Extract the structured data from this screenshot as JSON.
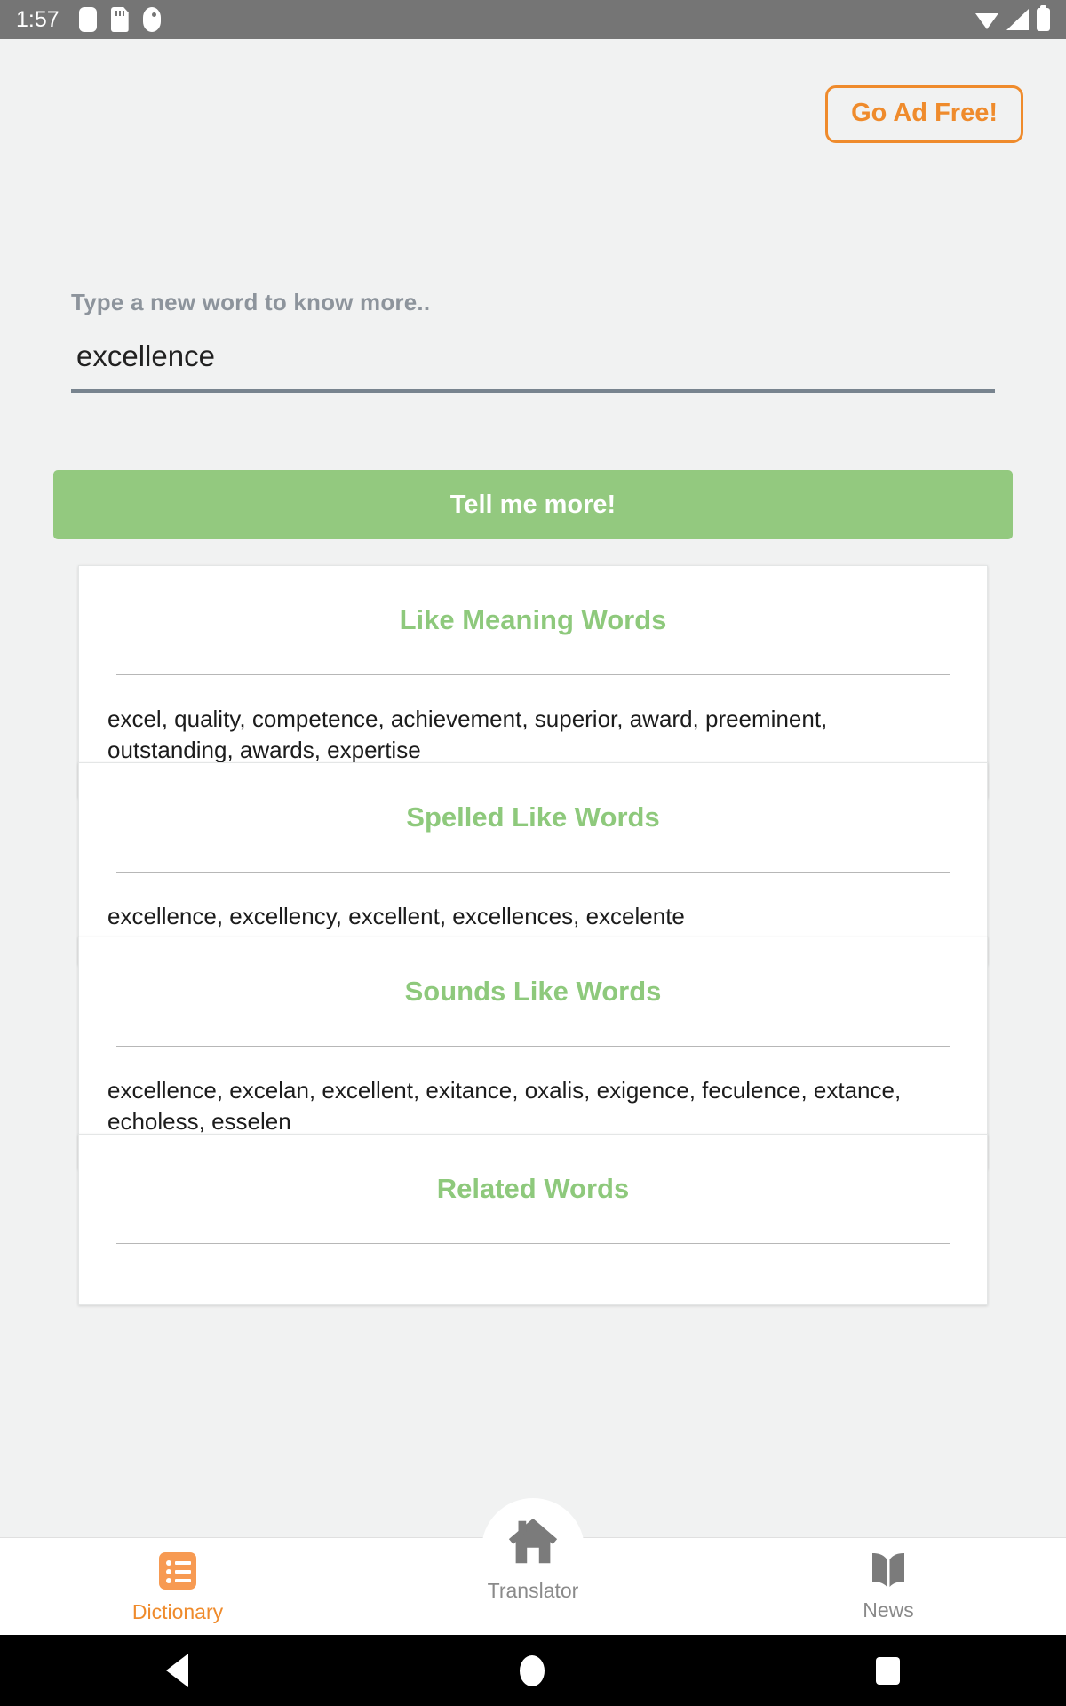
{
  "status_bar": {
    "clock": "1:57",
    "left_icons": [
      "app-notification-icon",
      "sd-card-icon",
      "app-badge-icon"
    ],
    "right_icons": [
      "wifi-icon",
      "cellular-signal-icon",
      "battery-icon"
    ],
    "background": "#757575"
  },
  "promo": {
    "label": "Go Ad Free!",
    "accent": "#ef8b2c"
  },
  "search": {
    "label": "Type a new word to know more..",
    "value": "excellence",
    "placeholder": "Type a new word to know more..",
    "submit_label": "Tell me more!",
    "submit_color": "#93c97f"
  },
  "cards": [
    {
      "title": "Like Meaning Words",
      "body": "excel, quality, competence, achievement, superior, award, preeminent, outstanding, awards, expertise"
    },
    {
      "title": "Spelled Like Words",
      "body": "excellence, excellency, excellent, excellences, excelente"
    },
    {
      "title": "Sounds Like Words",
      "body": "excellence, excelan, excellent, exitance, oxalis, exigence, feculence, extance, echoless, esselen"
    },
    {
      "title": "Related Words",
      "body": ""
    }
  ],
  "card_accent": "#8ec97c",
  "bottom_nav": {
    "items": [
      {
        "label": "Dictionary",
        "icon": "list-icon",
        "active": true
      },
      {
        "label": "Translator",
        "icon": "home-icon",
        "active": false
      },
      {
        "label": "News",
        "icon": "book-icon",
        "active": false
      }
    ],
    "active_color": "#ef8b2c",
    "inactive_color": "#8a8a8a"
  },
  "android_nav": {
    "back": "back-triangle-icon",
    "home": "home-circle-icon",
    "recents": "recents-square-icon"
  }
}
